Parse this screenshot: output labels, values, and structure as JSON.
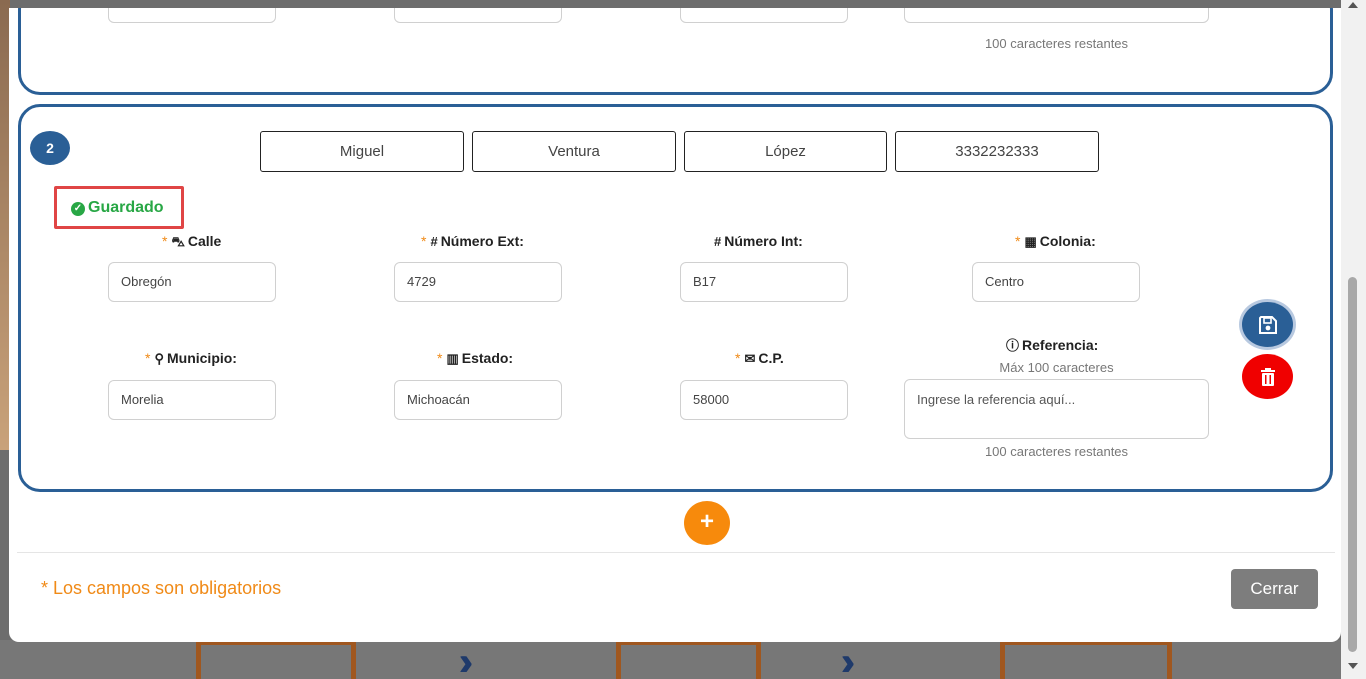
{
  "address_form_2": {
    "index": "2",
    "first_name": "Miguel",
    "last_name_1": "Ventura",
    "last_name_2": "López",
    "phone": "3332232333",
    "status": "Guardado",
    "fields": {
      "calle": {
        "label": "Calle",
        "value": "Obregón",
        "required": true
      },
      "numero_ext": {
        "label": "Número Ext:",
        "value": "4729",
        "required": true
      },
      "numero_int": {
        "label": "Número Int:",
        "value": "B17",
        "required": false
      },
      "colonia": {
        "label": "Colonia:",
        "value": "Centro",
        "required": true
      },
      "municipio": {
        "label": "Municipio:",
        "value": "Morelia",
        "required": true
      },
      "estado": {
        "label": "Estado:",
        "value": "Michoacán",
        "required": true
      },
      "cp": {
        "label": "C.P.",
        "value": "58000",
        "required": true
      },
      "referencia": {
        "label": "Referencia:",
        "hint": "Máx 100 caracteres",
        "placeholder": "Ingrese la referencia aquí...",
        "remaining": "100 caracteres restantes"
      }
    },
    "required_mark": "*"
  },
  "address_form_1": {
    "remaining": "100 caracteres restantes"
  },
  "icons": {
    "save": "floppy-disk-icon",
    "delete": "trash-icon",
    "add": "plus-icon"
  },
  "footer": {
    "required_note": "* Los campos son obligatorios",
    "close_label": "Cerrar"
  },
  "colors": {
    "primary": "#2a5f96",
    "accent": "#f78a0c",
    "success": "#28a745",
    "danger": "#f00000"
  }
}
